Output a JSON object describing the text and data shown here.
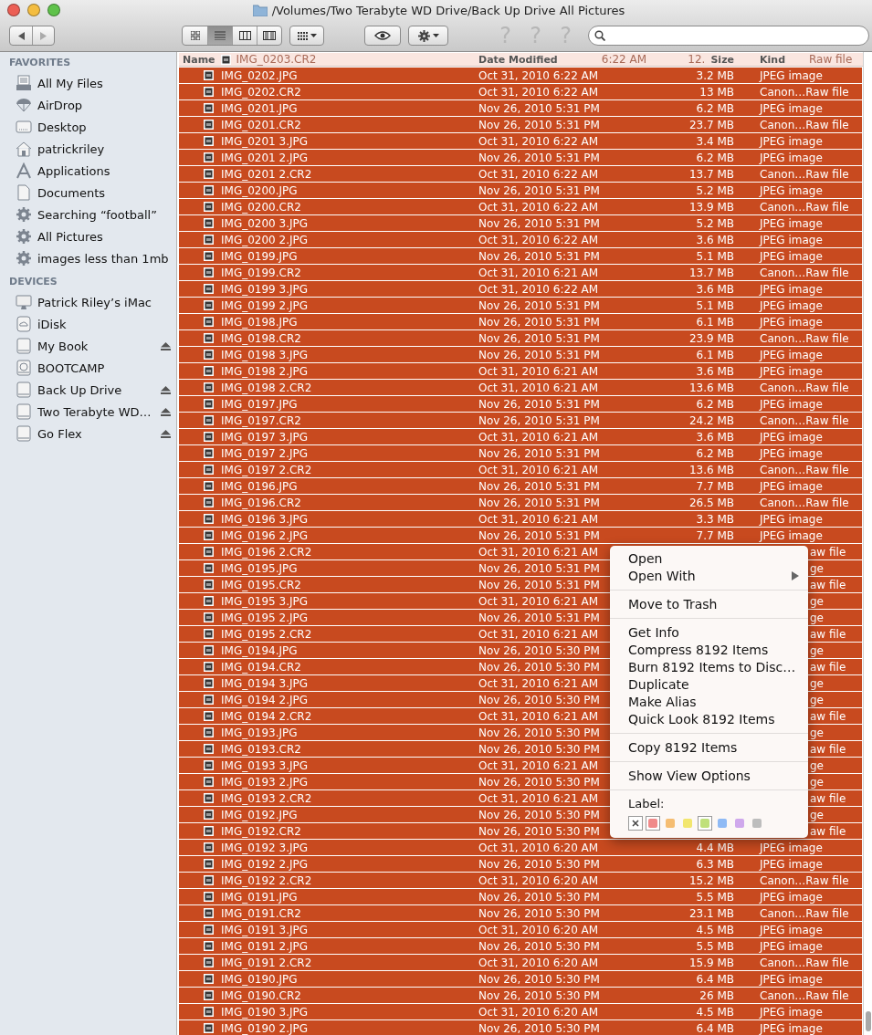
{
  "window": {
    "title": "/Volumes/Two Terabyte WD Drive/Back Up Drive All Pictures"
  },
  "toolbar": {
    "view_modes": [
      {
        "kind": "icons",
        "selected": false
      },
      {
        "kind": "list",
        "selected": true
      },
      {
        "kind": "columns",
        "selected": false
      },
      {
        "kind": "coverflow",
        "selected": false
      }
    ],
    "help_marks": [
      "?",
      "?",
      "?"
    ]
  },
  "sidebar": {
    "sections": [
      {
        "title": "FAVORITES",
        "items": [
          {
            "label": "All My Files",
            "kind": "files",
            "eject": false
          },
          {
            "label": "AirDrop",
            "kind": "airdrop",
            "eject": false
          },
          {
            "label": "Desktop",
            "kind": "desktop",
            "eject": false
          },
          {
            "label": "patrickriley",
            "kind": "home",
            "eject": false
          },
          {
            "label": "Applications",
            "kind": "apps",
            "eject": false
          },
          {
            "label": "Documents",
            "kind": "docs",
            "eject": false
          },
          {
            "label": "Searching “football”",
            "kind": "smart",
            "eject": false
          },
          {
            "label": "All Pictures",
            "kind": "smart",
            "eject": false
          },
          {
            "label": "images less than 1mb",
            "kind": "smart",
            "eject": false
          }
        ]
      },
      {
        "title": "DEVICES",
        "items": [
          {
            "label": "Patrick Riley’s iMac",
            "kind": "imac",
            "eject": false
          },
          {
            "label": "iDisk",
            "kind": "idisk",
            "eject": false
          },
          {
            "label": "My Book",
            "kind": "disk",
            "eject": true
          },
          {
            "label": "BOOTCAMP",
            "kind": "bootcamp",
            "eject": false
          },
          {
            "label": "Back Up Drive",
            "kind": "disk",
            "eject": true
          },
          {
            "label": "Two Terabyte WD…",
            "kind": "disk",
            "eject": true
          },
          {
            "label": "Go Flex",
            "kind": "disk",
            "eject": true
          }
        ]
      }
    ]
  },
  "columns": [
    "Name",
    "Date Modified",
    "Size",
    "Kind"
  ],
  "peek_row": {
    "name": "IMG_0203.CR2",
    "date_modified": "6:22 AM",
    "size": "12.",
    "kind": "Raw file"
  },
  "rows": [
    {
      "name": "IMG_0202.JPG",
      "date_modified": "Oct 31, 2010 6:22 AM",
      "size": "3.2 MB",
      "kind": "JPEG image",
      "selected": true
    },
    {
      "name": "IMG_0202.CR2",
      "date_modified": "Oct 31, 2010 6:22 AM",
      "size": "13 MB",
      "kind": "Canon…Raw file",
      "selected": true
    },
    {
      "name": "IMG_0201.JPG",
      "date_modified": "Nov 26, 2010 5:31 PM",
      "size": "6.2 MB",
      "kind": "JPEG image",
      "selected": true
    },
    {
      "name": "IMG_0201.CR2",
      "date_modified": "Nov 26, 2010 5:31 PM",
      "size": "23.7 MB",
      "kind": "Canon…Raw file",
      "selected": true
    },
    {
      "name": "IMG_0201 3.JPG",
      "date_modified": "Oct 31, 2010 6:22 AM",
      "size": "3.4 MB",
      "kind": "JPEG image",
      "selected": true
    },
    {
      "name": "IMG_0201 2.JPG",
      "date_modified": "Nov 26, 2010 5:31 PM",
      "size": "6.2 MB",
      "kind": "JPEG image",
      "selected": true
    },
    {
      "name": "IMG_0201 2.CR2",
      "date_modified": "Oct 31, 2010 6:22 AM",
      "size": "13.7 MB",
      "kind": "Canon…Raw file",
      "selected": true
    },
    {
      "name": "IMG_0200.JPG",
      "date_modified": "Nov 26, 2010 5:31 PM",
      "size": "5.2 MB",
      "kind": "JPEG image",
      "selected": true
    },
    {
      "name": "IMG_0200.CR2",
      "date_modified": "Oct 31, 2010 6:22 AM",
      "size": "13.9 MB",
      "kind": "Canon…Raw file",
      "selected": true
    },
    {
      "name": "IMG_0200 3.JPG",
      "date_modified": "Nov 26, 2010 5:31 PM",
      "size": "5.2 MB",
      "kind": "JPEG image",
      "selected": true
    },
    {
      "name": "IMG_0200 2.JPG",
      "date_modified": "Oct 31, 2010 6:22 AM",
      "size": "3.6 MB",
      "kind": "JPEG image",
      "selected": true
    },
    {
      "name": "IMG_0199.JPG",
      "date_modified": "Nov 26, 2010 5:31 PM",
      "size": "5.1 MB",
      "kind": "JPEG image",
      "selected": true
    },
    {
      "name": "IMG_0199.CR2",
      "date_modified": "Oct 31, 2010 6:21 AM",
      "size": "13.7 MB",
      "kind": "Canon…Raw file",
      "selected": true
    },
    {
      "name": "IMG_0199 3.JPG",
      "date_modified": "Oct 31, 2010 6:22 AM",
      "size": "3.6 MB",
      "kind": "JPEG image",
      "selected": true
    },
    {
      "name": "IMG_0199 2.JPG",
      "date_modified": "Nov 26, 2010 5:31 PM",
      "size": "5.1 MB",
      "kind": "JPEG image",
      "selected": true
    },
    {
      "name": "IMG_0198.JPG",
      "date_modified": "Nov 26, 2010 5:31 PM",
      "size": "6.1 MB",
      "kind": "JPEG image",
      "selected": true
    },
    {
      "name": "IMG_0198.CR2",
      "date_modified": "Nov 26, 2010 5:31 PM",
      "size": "23.9 MB",
      "kind": "Canon…Raw file",
      "selected": true
    },
    {
      "name": "IMG_0198 3.JPG",
      "date_modified": "Nov 26, 2010 5:31 PM",
      "size": "6.1 MB",
      "kind": "JPEG image",
      "selected": true
    },
    {
      "name": "IMG_0198 2.JPG",
      "date_modified": "Oct 31, 2010 6:21 AM",
      "size": "3.6 MB",
      "kind": "JPEG image",
      "selected": true
    },
    {
      "name": "IMG_0198 2.CR2",
      "date_modified": "Oct 31, 2010 6:21 AM",
      "size": "13.6 MB",
      "kind": "Canon…Raw file",
      "selected": true
    },
    {
      "name": "IMG_0197.JPG",
      "date_modified": "Nov 26, 2010 5:31 PM",
      "size": "6.2 MB",
      "kind": "JPEG image",
      "selected": true
    },
    {
      "name": "IMG_0197.CR2",
      "date_modified": "Nov 26, 2010 5:31 PM",
      "size": "24.2 MB",
      "kind": "Canon…Raw file",
      "selected": true
    },
    {
      "name": "IMG_0197 3.JPG",
      "date_modified": "Oct 31, 2010 6:21 AM",
      "size": "3.6 MB",
      "kind": "JPEG image",
      "selected": true
    },
    {
      "name": "IMG_0197 2.JPG",
      "date_modified": "Nov 26, 2010 5:31 PM",
      "size": "6.2 MB",
      "kind": "JPEG image",
      "selected": true
    },
    {
      "name": "IMG_0197 2.CR2",
      "date_modified": "Oct 31, 2010 6:21 AM",
      "size": "13.6 MB",
      "kind": "Canon…Raw file",
      "selected": true
    },
    {
      "name": "IMG_0196.JPG",
      "date_modified": "Nov 26, 2010 5:31 PM",
      "size": "7.7 MB",
      "kind": "JPEG image",
      "selected": true
    },
    {
      "name": "IMG_0196.CR2",
      "date_modified": "Nov 26, 2010 5:31 PM",
      "size": "26.5 MB",
      "kind": "Canon…Raw file",
      "selected": true
    },
    {
      "name": "IMG_0196 3.JPG",
      "date_modified": "Oct 31, 2010 6:21 AM",
      "size": "3.3 MB",
      "kind": "JPEG image",
      "selected": true
    },
    {
      "name": "IMG_0196 2.JPG",
      "date_modified": "Nov 26, 2010 5:31 PM",
      "size": "7.7 MB",
      "kind": "JPEG image",
      "selected": true
    },
    {
      "name": "IMG_0196 2.CR2",
      "date_modified": "Oct 31, 2010 6:21 AM",
      "kind": "aw file",
      "selected": true
    },
    {
      "name": "IMG_0195.JPG",
      "date_modified": "Nov 26, 2010 5:31 PM",
      "kind": "ge",
      "selected": true
    },
    {
      "name": "IMG_0195.CR2",
      "date_modified": "Nov 26, 2010 5:31 PM",
      "kind": "aw file",
      "selected": true
    },
    {
      "name": "IMG_0195 3.JPG",
      "date_modified": "Oct 31, 2010 6:21 AM",
      "kind": "ge",
      "selected": true
    },
    {
      "name": "IMG_0195 2.JPG",
      "date_modified": "Nov 26, 2010 5:31 PM",
      "kind": "ge",
      "selected": true
    },
    {
      "name": "IMG_0195 2.CR2",
      "date_modified": "Oct 31, 2010 6:21 AM",
      "kind": "aw file",
      "selected": true
    },
    {
      "name": "IMG_0194.JPG",
      "date_modified": "Nov 26, 2010 5:30 PM",
      "kind": "ge",
      "selected": true
    },
    {
      "name": "IMG_0194.CR2",
      "date_modified": "Nov 26, 2010 5:30 PM",
      "kind": "aw file",
      "selected": true
    },
    {
      "name": "IMG_0194 3.JPG",
      "date_modified": "Oct 31, 2010 6:21 AM",
      "kind": "ge",
      "selected": true
    },
    {
      "name": "IMG_0194 2.JPG",
      "date_modified": "Nov 26, 2010 5:30 PM",
      "kind": "ge",
      "selected": true
    },
    {
      "name": "IMG_0194 2.CR2",
      "date_modified": "Oct 31, 2010 6:21 AM",
      "kind": "aw file",
      "selected": true
    },
    {
      "name": "IMG_0193.JPG",
      "date_modified": "Nov 26, 2010 5:30 PM",
      "kind": "ge",
      "selected": true
    },
    {
      "name": "IMG_0193.CR2",
      "date_modified": "Nov 26, 2010 5:30 PM",
      "kind": "aw file",
      "selected": true
    },
    {
      "name": "IMG_0193 3.JPG",
      "date_modified": "Oct 31, 2010 6:21 AM",
      "kind": "ge",
      "selected": true
    },
    {
      "name": "IMG_0193 2.JPG",
      "date_modified": "Nov 26, 2010 5:30 PM",
      "kind": "ge",
      "selected": true
    },
    {
      "name": "IMG_0193 2.CR2",
      "date_modified": "Oct 31, 2010 6:21 AM",
      "kind": "aw file",
      "selected": true
    },
    {
      "name": "IMG_0192.JPG",
      "date_modified": "Nov 26, 2010 5:30 PM",
      "kind": "ge",
      "selected": true
    },
    {
      "name": "IMG_0192.CR2",
      "date_modified": "Nov 26, 2010 5:30 PM",
      "kind": "aw file",
      "selected": true
    },
    {
      "name": "IMG_0192 3.JPG",
      "date_modified": "Oct 31, 2010 6:20 AM",
      "size": "4.4 MB",
      "kind": "JPEG image",
      "selected": true
    },
    {
      "name": "IMG_0192 2.JPG",
      "date_modified": "Nov 26, 2010 5:30 PM",
      "size": "6.3 MB",
      "kind": "JPEG image",
      "selected": true
    },
    {
      "name": "IMG_0192 2.CR2",
      "date_modified": "Oct 31, 2010 6:20 AM",
      "size": "15.2 MB",
      "kind": "Canon…Raw file",
      "selected": true
    },
    {
      "name": "IMG_0191.JPG",
      "date_modified": "Nov 26, 2010 5:30 PM",
      "size": "5.5 MB",
      "kind": "JPEG image",
      "selected": true
    },
    {
      "name": "IMG_0191.CR2",
      "date_modified": "Nov 26, 2010 5:30 PM",
      "size": "23.1 MB",
      "kind": "Canon…Raw file",
      "selected": true
    },
    {
      "name": "IMG_0191 3.JPG",
      "date_modified": "Oct 31, 2010 6:20 AM",
      "size": "4.5 MB",
      "kind": "JPEG image",
      "selected": true
    },
    {
      "name": "IMG_0191 2.JPG",
      "date_modified": "Nov 26, 2010 5:30 PM",
      "size": "5.5 MB",
      "kind": "JPEG image",
      "selected": true
    },
    {
      "name": "IMG_0191 2.CR2",
      "date_modified": "Oct 31, 2010 6:20 AM",
      "size": "15.9 MB",
      "kind": "Canon…Raw file",
      "selected": true
    },
    {
      "name": "IMG_0190.JPG",
      "date_modified": "Nov 26, 2010 5:30 PM",
      "size": "6.4 MB",
      "kind": "JPEG image",
      "selected": true
    },
    {
      "name": "IMG_0190.CR2",
      "date_modified": "Nov 26, 2010 5:30 PM",
      "size": "26 MB",
      "kind": "Canon…Raw file",
      "selected": true
    },
    {
      "name": "IMG_0190 3.JPG",
      "date_modified": "Oct 31, 2010 6:20 AM",
      "size": "4.5 MB",
      "kind": "JPEG image",
      "selected": true
    },
    {
      "name": "IMG_0190 2.JPG",
      "date_modified": "Nov 26, 2010 5:30 PM",
      "size": "6.4 MB",
      "kind": "JPEG image",
      "selected": true
    }
  ],
  "context_menu": {
    "groups": [
      [
        {
          "label": "Open",
          "submenu": false
        },
        {
          "label": "Open With",
          "submenu": true
        }
      ],
      [
        {
          "label": "Move to Trash",
          "submenu": false
        }
      ],
      [
        {
          "label": "Get Info",
          "submenu": false
        },
        {
          "label": "Compress 8192 Items",
          "submenu": false
        },
        {
          "label": "Burn 8192 Items to Disc…",
          "submenu": false
        },
        {
          "label": "Duplicate",
          "submenu": false
        },
        {
          "label": "Make Alias",
          "submenu": false
        },
        {
          "label": "Quick Look 8192 Items",
          "submenu": false
        }
      ],
      [
        {
          "label": "Copy 8192 Items",
          "submenu": false
        }
      ],
      [
        {
          "label": "Show View Options",
          "submenu": false
        }
      ]
    ],
    "label_title": "Label:",
    "swatches": [
      {
        "kind": "none",
        "selected": true
      },
      {
        "kind": "color",
        "color": "#f08a8a",
        "selected": true
      },
      {
        "kind": "color",
        "color": "#f5bd72",
        "selected": false
      },
      {
        "kind": "color",
        "color": "#f2e66e",
        "selected": false
      },
      {
        "kind": "color",
        "color": "#bfe07a",
        "selected": true
      },
      {
        "kind": "color",
        "color": "#8fbaf5",
        "selected": false
      },
      {
        "kind": "color",
        "color": "#cfa8ec",
        "selected": false
      },
      {
        "kind": "color",
        "color": "#bdbdbd",
        "selected": false
      }
    ]
  }
}
